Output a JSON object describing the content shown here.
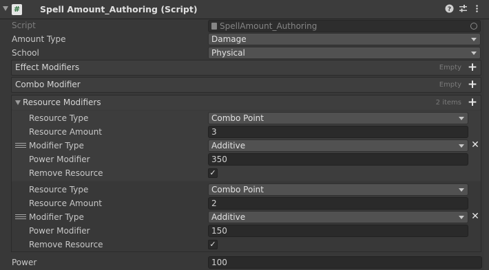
{
  "header": {
    "script_icon_glyph": "#",
    "title": "Spell Amount_Authoring (Script)",
    "help_icon": "help-icon",
    "preset_icon": "preset-icon",
    "menu_icon": "kebab-menu-icon"
  },
  "script_row": {
    "label": "Script",
    "value": "SpellAmount_Authoring"
  },
  "amount_type": {
    "label": "Amount Type",
    "value": "Damage"
  },
  "school": {
    "label": "School",
    "value": "Physical"
  },
  "effect_modifiers": {
    "label": "Effect Modifiers",
    "status": "Empty",
    "add_icon": "plus-icon"
  },
  "combo_modifier": {
    "label": "Combo Modifier",
    "status": "Empty",
    "add_icon": "plus-icon"
  },
  "resource_modifiers": {
    "label": "Resource Modifiers",
    "count": "2 items",
    "elements": [
      {
        "resource_type_label": "Resource Type",
        "resource_type": "Combo Point",
        "resource_amount_label": "Resource Amount",
        "resource_amount": "3",
        "modifier_type_label": "Modifier Type",
        "modifier_type": "Additive",
        "power_modifier_label": "Power Modifier",
        "power_modifier": "350",
        "remove_resource_label": "Remove Resource",
        "remove_resource_glyph": "✓"
      },
      {
        "resource_type_label": "Resource Type",
        "resource_type": "Combo Point",
        "resource_amount_label": "Resource Amount",
        "resource_amount": "2",
        "modifier_type_label": "Modifier Type",
        "modifier_type": "Additive",
        "power_modifier_label": "Power Modifier",
        "power_modifier": "150",
        "remove_resource_label": "Remove Resource",
        "remove_resource_glyph": "✓"
      }
    ]
  },
  "power": {
    "label": "Power",
    "value": "100"
  }
}
